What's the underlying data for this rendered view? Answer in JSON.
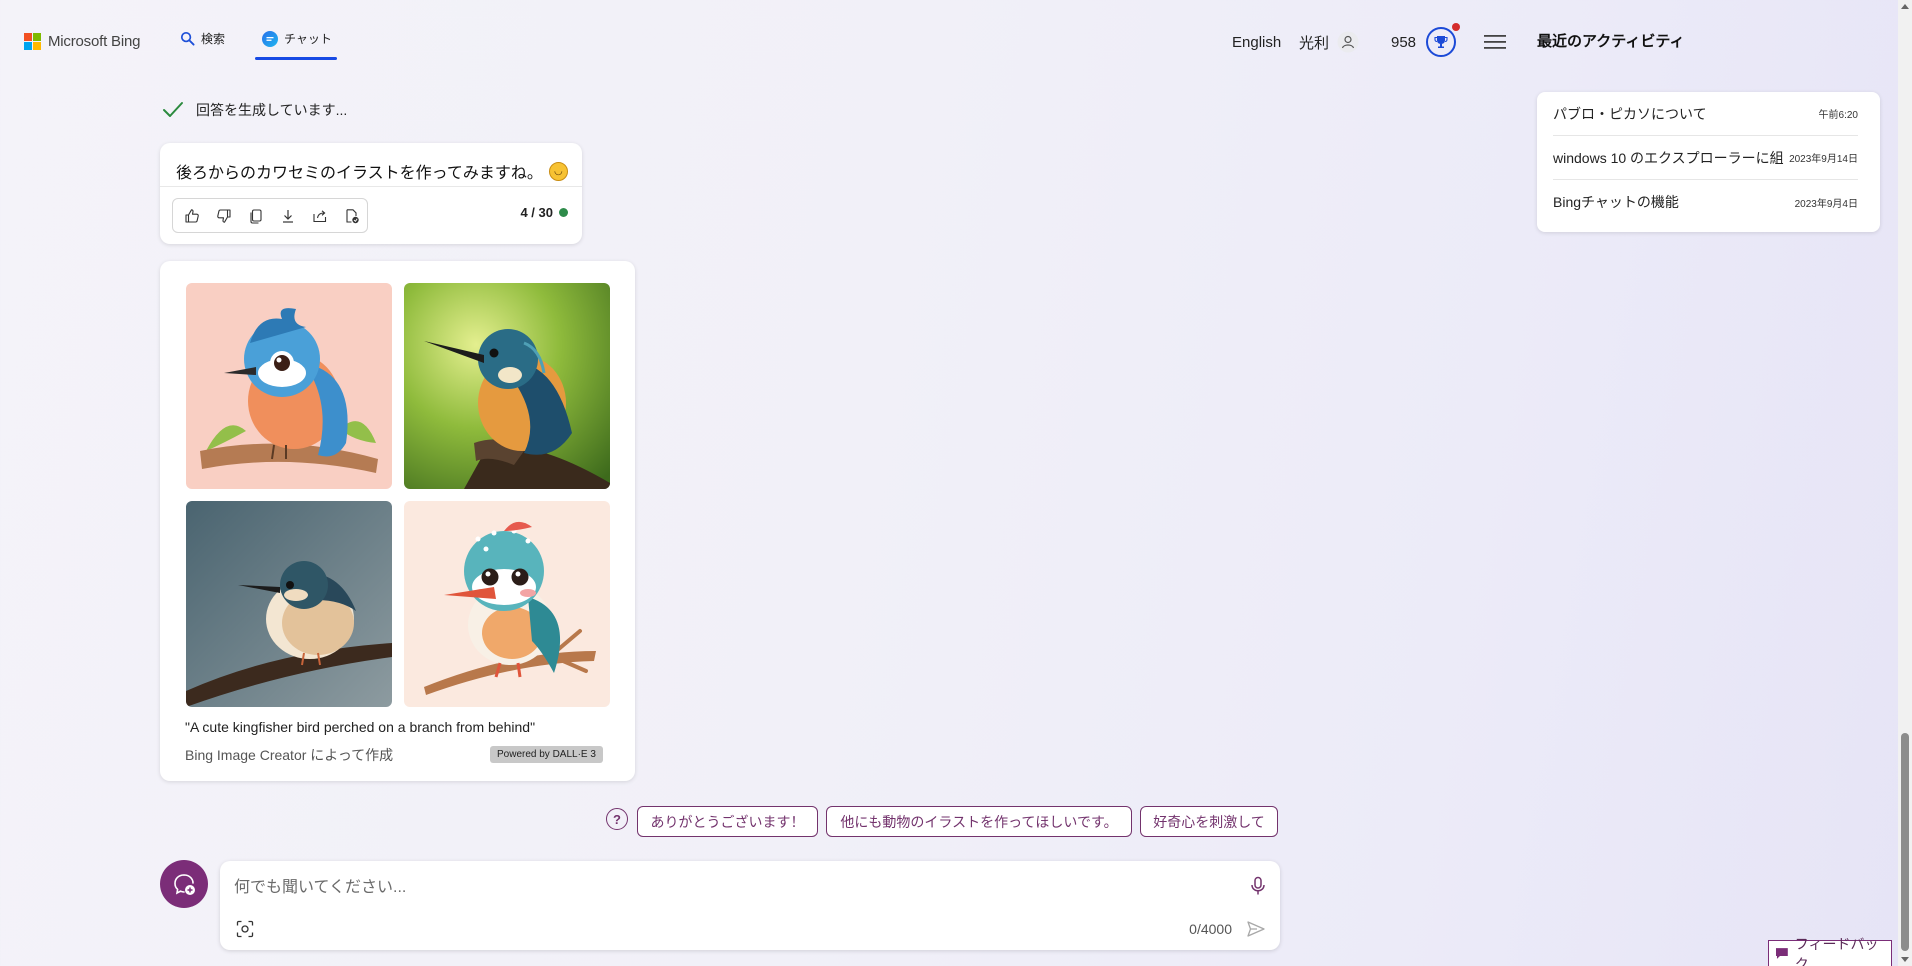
{
  "header": {
    "logo_text": "Microsoft Bing",
    "nav": {
      "search_label": "検索",
      "chat_label": "チャット"
    },
    "language_label": "English",
    "user_name": "光利",
    "points": "958",
    "colors": {
      "accent": "#174ae4",
      "brand": "#7b2d78"
    }
  },
  "recent": {
    "title": "最近のアクティビティ",
    "items": [
      {
        "title": "パブロ・ピカソについて",
        "date": "午前6:20"
      },
      {
        "title": "windows 10 のエクスプローラーに組",
        "date": "2023年9月14日"
      },
      {
        "title": "Bingチャットの機能",
        "date": "2023年9月4日"
      }
    ]
  },
  "chat": {
    "status_text": "回答を生成しています...",
    "response_text": "後ろからのカワセミのイラストを作ってみますね。",
    "turn_count": "4 / 30",
    "image_caption": "\"A cute kingfisher bird perched on a branch from behind\"",
    "image_creator": "Bing Image Creator によって作成",
    "dalle_badge": "Powered by DALL·E 3"
  },
  "suggestions": [
    "ありがとうございます！",
    "他にも動物のイラストを作ってほしいです。",
    "好奇心を刺激して"
  ],
  "composer": {
    "placeholder": "何でも聞いてください...",
    "char_count": "0/4000"
  },
  "feedback_label": "フィードバック",
  "icons": {
    "header": [
      "microsoft-logo-icon",
      "search-icon",
      "chat-icon",
      "user-icon",
      "trophy-icon",
      "menu-icon"
    ],
    "actions": [
      "like-icon",
      "dislike-icon",
      "copy-icon",
      "download-icon",
      "share-icon",
      "export-icon"
    ],
    "composer": [
      "new-topic-icon",
      "microphone-icon",
      "image-search-icon",
      "send-icon"
    ]
  }
}
